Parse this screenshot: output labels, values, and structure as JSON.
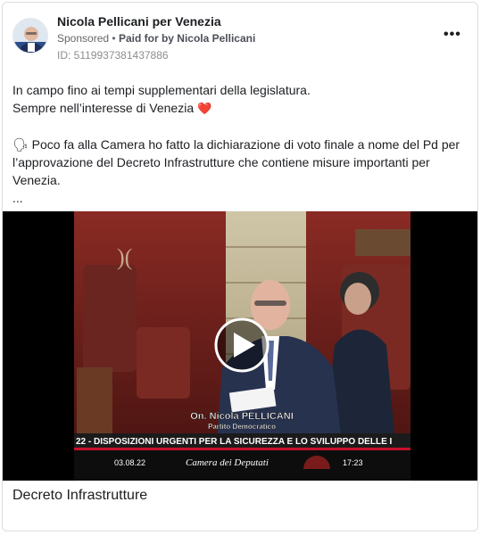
{
  "post": {
    "page_name": "Nicola Pellicani per Venezia",
    "sponsored": "Sponsored",
    "paid_for": "Paid for by Nicola Pellicani",
    "separator": "•",
    "ad_id": "ID: 5119937381437886",
    "more_icon": "more-dots-icon",
    "text_lines": [
      "In campo fino ai tempi supplementari della legislatura.",
      "Sempre nell’interesse di Venezia",
      "🗣 Poco fa alla Camera ho fatto la dichiarazione di voto finale a nome del Pd per",
      "l’approvazione del Decreto Infrastrutture che contiene misure importanti per",
      "Venezia.",
      "..."
    ],
    "heart": "❤️"
  },
  "video": {
    "name_caption": "On. Nicola PELLICANI",
    "party_caption": "Partito Democratico",
    "ticker": "22 - DISPOSIZIONI URGENTI PER LA SICUREZZA E LO SVILUPPO DELLE I",
    "date": "03.08.22",
    "channel": "Camera dei Deputati",
    "time": "17:23"
  },
  "caption": "Decreto Infrastrutture",
  "colors": {
    "accent_red": "#c8102e",
    "ticker_bg": "#1b1b1b"
  }
}
